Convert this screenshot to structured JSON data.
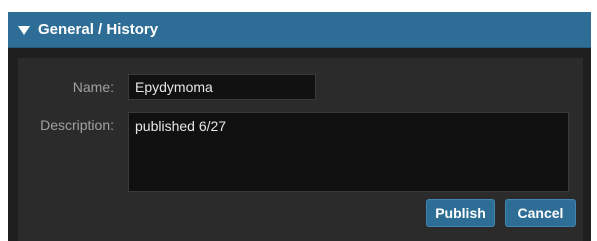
{
  "section": {
    "title": "General / History",
    "expanded": true,
    "toggle_icon": "triangle-down-icon"
  },
  "form": {
    "name_label": "Name:",
    "name_value": "Epydymoma",
    "description_label": "Description:",
    "description_value": "published 6/27"
  },
  "actions": {
    "publish_label": "Publish",
    "cancel_label": "Cancel"
  },
  "colors": {
    "accent": "#2e6e96",
    "panel_background": "#2b2b2b",
    "input_background": "#111111"
  }
}
